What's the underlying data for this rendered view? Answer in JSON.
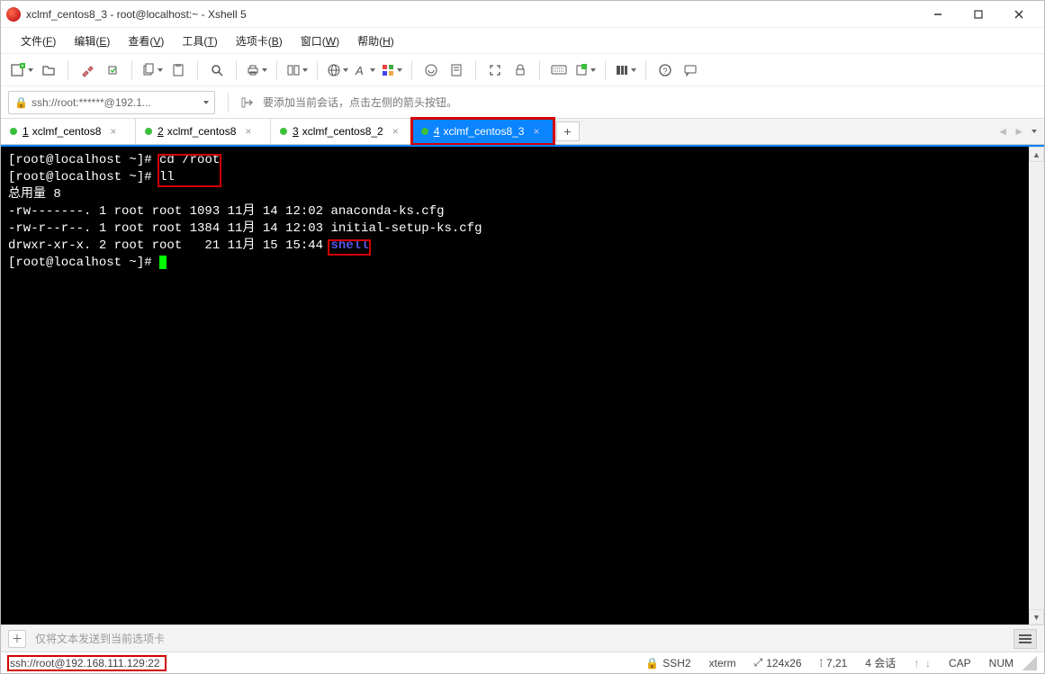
{
  "title": "xclmf_centos8_3 - root@localhost:~ - Xshell 5",
  "menubar": [
    {
      "label": "文件",
      "letter": "F"
    },
    {
      "label": "编辑",
      "letter": "E"
    },
    {
      "label": "查看",
      "letter": "V"
    },
    {
      "label": "工具",
      "letter": "T"
    },
    {
      "label": "选项卡",
      "letter": "B"
    },
    {
      "label": "窗口",
      "letter": "W"
    },
    {
      "label": "帮助",
      "letter": "H"
    }
  ],
  "address": {
    "url": "ssh://root:******@192.1...",
    "hint": "要添加当前会话，点击左侧的箭头按钮。"
  },
  "tabs": [
    {
      "num": "1",
      "label": "xclmf_centos8",
      "active": false
    },
    {
      "num": "2",
      "label": "xclmf_centos8",
      "active": false
    },
    {
      "num": "3",
      "label": "xclmf_centos8_2",
      "active": false
    },
    {
      "num": "4",
      "label": "xclmf_centos8_3",
      "active": true
    }
  ],
  "terminal": {
    "prompt": "[root@localhost ~]#",
    "cmd1": "cd /root",
    "cmd2": "ll",
    "total": "总用量 8",
    "row1": "-rw-------. 1 root root 1093 11月 14 12:02 anaconda-ks.cfg",
    "row2": "-rw-r--r--. 1 root root 1384 11月 14 12:03 initial-setup-ks.cfg",
    "row3a": "drwxr-xr-x. 2 root root   21 11月 15 15:44 ",
    "row3b": "shell"
  },
  "input": {
    "placeholder": "仅将文本发送到当前选项卡"
  },
  "status": {
    "connection": "ssh://root@192.168.111.129:22",
    "proto": "SSH2",
    "term": "xterm",
    "size": "124x26",
    "cursor_pos": "7,21",
    "sess": "4 会话",
    "caps": "CAP",
    "num": "NUM"
  }
}
